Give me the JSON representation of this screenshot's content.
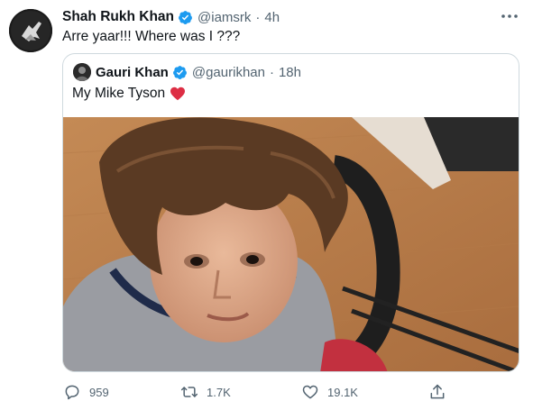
{
  "tweet": {
    "author_name": "Shah Rukh Khan",
    "author_handle": "@iamsrk",
    "separator": "·",
    "time": "4h",
    "text": "Arre yaar!!! Where was I ???"
  },
  "quoted_tweet": {
    "author_name": "Gauri Khan",
    "author_handle": "@gaurikhan",
    "separator": "·",
    "time": "18h",
    "text": "My Mike Tyson"
  },
  "actions": {
    "replies": "959",
    "retweets": "1.7K",
    "likes": "19.1K"
  },
  "icons": {
    "verified": "verified-badge-icon",
    "more": "more-options-icon",
    "reply": "reply-icon",
    "retweet": "retweet-icon",
    "like": "like-icon",
    "share": "share-icon",
    "emoji": "red-heart-icon"
  },
  "colors": {
    "verified": "#1d9bf0",
    "text": "#0f1419",
    "secondary": "#536471",
    "border": "#cfd9de",
    "heart": "#e0245e"
  }
}
